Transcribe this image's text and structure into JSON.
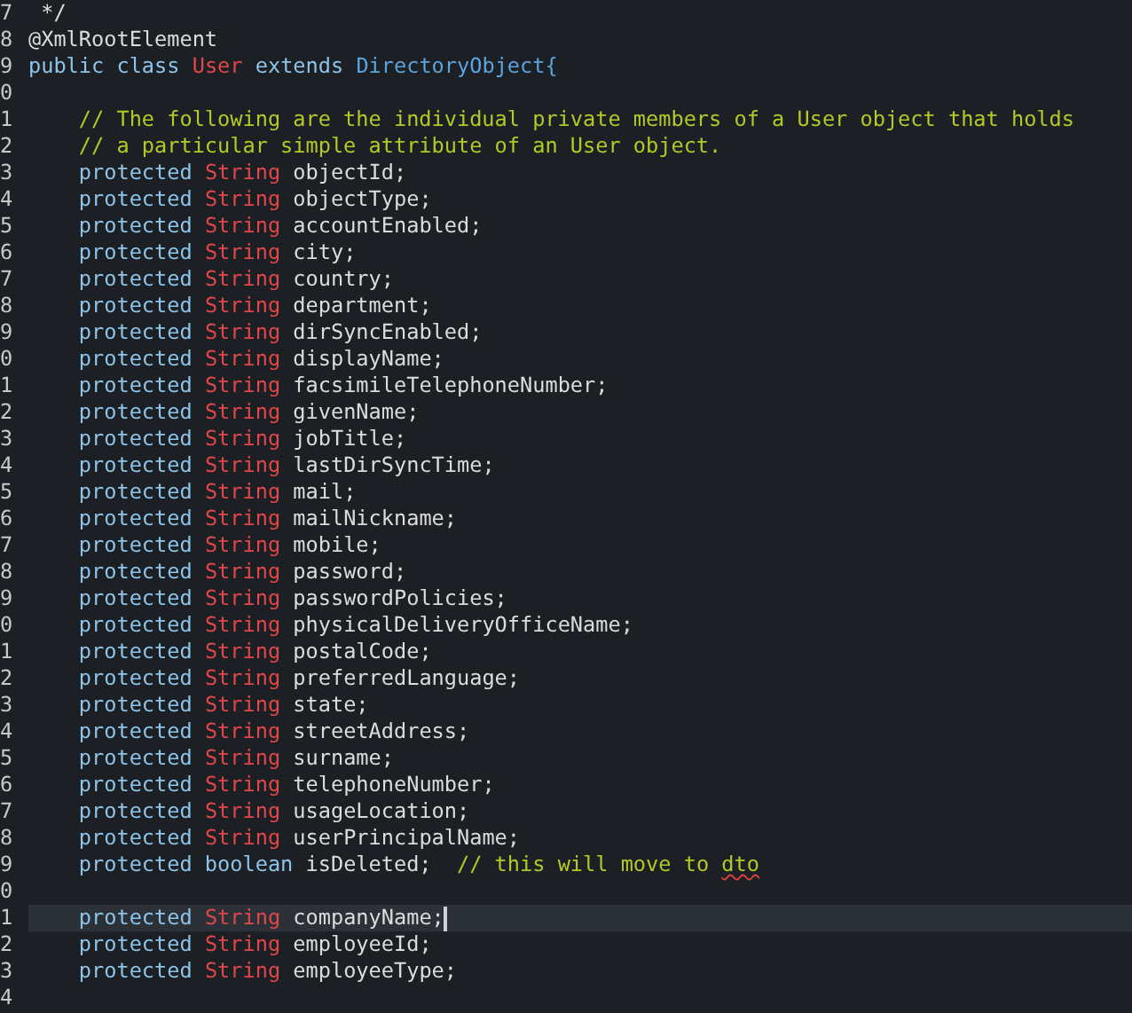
{
  "editor": {
    "lines": [
      {
        "number": "7",
        "current": false,
        "tokens": [
          {
            "kind": "plain",
            "text": " */"
          }
        ]
      },
      {
        "number": "8",
        "current": false,
        "tokens": [
          {
            "kind": "plain",
            "text": "@XmlRootElement"
          }
        ]
      },
      {
        "number": "9",
        "current": false,
        "tokens": [
          {
            "kind": "keyword",
            "text": "public class "
          },
          {
            "kind": "type",
            "text": "User"
          },
          {
            "kind": "keyword",
            "text": " extends "
          },
          {
            "kind": "classref",
            "text": "DirectoryObject{"
          }
        ]
      },
      {
        "number": "0",
        "current": false
      },
      {
        "number": "1",
        "current": false,
        "tokens": [
          {
            "kind": "comment",
            "text": "    // The following are the individual private members of a User object that holds"
          }
        ]
      },
      {
        "number": "2",
        "current": false,
        "tokens": [
          {
            "kind": "comment",
            "text": "    // a particular simple attribute of an User object."
          }
        ]
      },
      {
        "number": "3",
        "current": false,
        "tokens": [
          {
            "kind": "keyword",
            "text": "    protected "
          },
          {
            "kind": "type",
            "text": "String"
          },
          {
            "kind": "plain",
            "text": " objectId;"
          }
        ]
      },
      {
        "number": "4",
        "current": false,
        "tokens": [
          {
            "kind": "keyword",
            "text": "    protected "
          },
          {
            "kind": "type",
            "text": "String"
          },
          {
            "kind": "plain",
            "text": " objectType;"
          }
        ]
      },
      {
        "number": "5",
        "current": false,
        "tokens": [
          {
            "kind": "keyword",
            "text": "    protected "
          },
          {
            "kind": "type",
            "text": "String"
          },
          {
            "kind": "plain",
            "text": " accountEnabled;"
          }
        ]
      },
      {
        "number": "6",
        "current": false,
        "tokens": [
          {
            "kind": "keyword",
            "text": "    protected "
          },
          {
            "kind": "type",
            "text": "String"
          },
          {
            "kind": "plain",
            "text": " city;"
          }
        ]
      },
      {
        "number": "7",
        "current": false,
        "tokens": [
          {
            "kind": "keyword",
            "text": "    protected "
          },
          {
            "kind": "type",
            "text": "String"
          },
          {
            "kind": "plain",
            "text": " country;"
          }
        ]
      },
      {
        "number": "8",
        "current": false,
        "tokens": [
          {
            "kind": "keyword",
            "text": "    protected "
          },
          {
            "kind": "type",
            "text": "String"
          },
          {
            "kind": "plain",
            "text": " department;"
          }
        ]
      },
      {
        "number": "9",
        "current": false,
        "tokens": [
          {
            "kind": "keyword",
            "text": "    protected "
          },
          {
            "kind": "type",
            "text": "String"
          },
          {
            "kind": "plain",
            "text": " dirSyncEnabled;"
          }
        ]
      },
      {
        "number": "0",
        "current": false,
        "tokens": [
          {
            "kind": "keyword",
            "text": "    protected "
          },
          {
            "kind": "type",
            "text": "String"
          },
          {
            "kind": "plain",
            "text": " displayName;"
          }
        ]
      },
      {
        "number": "1",
        "current": false,
        "tokens": [
          {
            "kind": "keyword",
            "text": "    protected "
          },
          {
            "kind": "type",
            "text": "String"
          },
          {
            "kind": "plain",
            "text": " facsimileTelephoneNumber;"
          }
        ]
      },
      {
        "number": "2",
        "current": false,
        "tokens": [
          {
            "kind": "keyword",
            "text": "    protected "
          },
          {
            "kind": "type",
            "text": "String"
          },
          {
            "kind": "plain",
            "text": " givenName;"
          }
        ]
      },
      {
        "number": "3",
        "current": false,
        "tokens": [
          {
            "kind": "keyword",
            "text": "    protected "
          },
          {
            "kind": "type",
            "text": "String"
          },
          {
            "kind": "plain",
            "text": " jobTitle;"
          }
        ]
      },
      {
        "number": "4",
        "current": false,
        "tokens": [
          {
            "kind": "keyword",
            "text": "    protected "
          },
          {
            "kind": "type",
            "text": "String"
          },
          {
            "kind": "plain",
            "text": " lastDirSyncTime;"
          }
        ]
      },
      {
        "number": "5",
        "current": false,
        "tokens": [
          {
            "kind": "keyword",
            "text": "    protected "
          },
          {
            "kind": "type",
            "text": "String"
          },
          {
            "kind": "plain",
            "text": " mail;"
          }
        ]
      },
      {
        "number": "6",
        "current": false,
        "tokens": [
          {
            "kind": "keyword",
            "text": "    protected "
          },
          {
            "kind": "type",
            "text": "String"
          },
          {
            "kind": "plain",
            "text": " mailNickname;"
          }
        ]
      },
      {
        "number": "7",
        "current": false,
        "tokens": [
          {
            "kind": "keyword",
            "text": "    protected "
          },
          {
            "kind": "type",
            "text": "String"
          },
          {
            "kind": "plain",
            "text": " mobile;"
          }
        ]
      },
      {
        "number": "8",
        "current": false,
        "tokens": [
          {
            "kind": "keyword",
            "text": "    protected "
          },
          {
            "kind": "type",
            "text": "String"
          },
          {
            "kind": "plain",
            "text": " password;"
          }
        ]
      },
      {
        "number": "9",
        "current": false,
        "tokens": [
          {
            "kind": "keyword",
            "text": "    protected "
          },
          {
            "kind": "type",
            "text": "String"
          },
          {
            "kind": "plain",
            "text": " passwordPolicies;"
          }
        ]
      },
      {
        "number": "0",
        "current": false,
        "tokens": [
          {
            "kind": "keyword",
            "text": "    protected "
          },
          {
            "kind": "type",
            "text": "String"
          },
          {
            "kind": "plain",
            "text": " physicalDeliveryOfficeName;"
          }
        ]
      },
      {
        "number": "1",
        "current": false,
        "tokens": [
          {
            "kind": "keyword",
            "text": "    protected "
          },
          {
            "kind": "type",
            "text": "String"
          },
          {
            "kind": "plain",
            "text": " postalCode;"
          }
        ]
      },
      {
        "number": "2",
        "current": false,
        "tokens": [
          {
            "kind": "keyword",
            "text": "    protected "
          },
          {
            "kind": "type",
            "text": "String"
          },
          {
            "kind": "plain",
            "text": " preferredLanguage;"
          }
        ]
      },
      {
        "number": "3",
        "current": false,
        "tokens": [
          {
            "kind": "keyword",
            "text": "    protected "
          },
          {
            "kind": "type",
            "text": "String"
          },
          {
            "kind": "plain",
            "text": " state;"
          }
        ]
      },
      {
        "number": "4",
        "current": false,
        "tokens": [
          {
            "kind": "keyword",
            "text": "    protected "
          },
          {
            "kind": "type",
            "text": "String"
          },
          {
            "kind": "plain",
            "text": " streetAddress;"
          }
        ]
      },
      {
        "number": "5",
        "current": false,
        "tokens": [
          {
            "kind": "keyword",
            "text": "    protected "
          },
          {
            "kind": "type",
            "text": "String"
          },
          {
            "kind": "plain",
            "text": " surname;"
          }
        ]
      },
      {
        "number": "6",
        "current": false,
        "tokens": [
          {
            "kind": "keyword",
            "text": "    protected "
          },
          {
            "kind": "type",
            "text": "String"
          },
          {
            "kind": "plain",
            "text": " telephoneNumber;"
          }
        ]
      },
      {
        "number": "7",
        "current": false,
        "tokens": [
          {
            "kind": "keyword",
            "text": "    protected "
          },
          {
            "kind": "type",
            "text": "String"
          },
          {
            "kind": "plain",
            "text": " usageLocation;"
          }
        ]
      },
      {
        "number": "8",
        "current": false,
        "tokens": [
          {
            "kind": "keyword",
            "text": "    protected "
          },
          {
            "kind": "type",
            "text": "String"
          },
          {
            "kind": "plain",
            "text": " userPrincipalName;"
          }
        ]
      },
      {
        "number": "9",
        "current": false,
        "tokens": [
          {
            "kind": "keyword",
            "text": "    protected boolean"
          },
          {
            "kind": "plain",
            "text": " isDeleted;  "
          },
          {
            "kind": "comment",
            "text": "// this will move to "
          },
          {
            "kind": "misspelled",
            "text": "dto"
          }
        ]
      },
      {
        "number": "0",
        "current": false
      },
      {
        "number": "1",
        "current": true,
        "tokens": [
          {
            "kind": "keyword",
            "text": "    protected "
          },
          {
            "kind": "type",
            "text": "String"
          },
          {
            "kind": "plain",
            "text": " companyName;"
          }
        ]
      },
      {
        "number": "2",
        "current": false,
        "tokens": [
          {
            "kind": "keyword",
            "text": "    protected "
          },
          {
            "kind": "type",
            "text": "String"
          },
          {
            "kind": "plain",
            "text": " employeeId;"
          }
        ]
      },
      {
        "number": "3",
        "current": false,
        "tokens": [
          {
            "kind": "keyword",
            "text": "    protected "
          },
          {
            "kind": "type",
            "text": "String"
          },
          {
            "kind": "plain",
            "text": " employeeType;"
          }
        ]
      },
      {
        "number": "4",
        "current": false
      }
    ]
  }
}
